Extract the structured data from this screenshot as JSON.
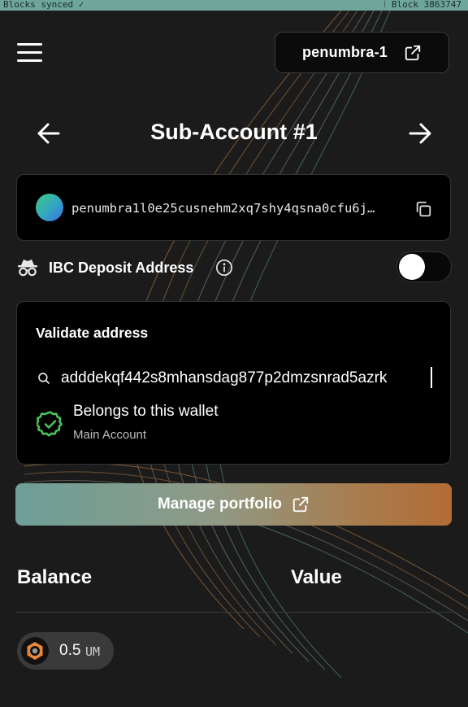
{
  "status_bar": {
    "sync_status": "Blocks synced ✓",
    "block_text": "⁝ Block 3863747"
  },
  "header": {
    "menu_icon": "hamburger-menu-icon",
    "chain_label": "penumbra-1",
    "external_icon": "external-link-icon"
  },
  "account": {
    "prev_icon": "arrow-left-icon",
    "title": "Sub-Account #1",
    "next_icon": "arrow-right-icon"
  },
  "address": {
    "text": "penumbra1l0e25cusnehm2xq7shy4qsna0cfu6j…",
    "copy_icon": "copy-icon"
  },
  "ibc": {
    "icon": "incognito-spy-icon",
    "label": "IBC Deposit Address",
    "info_icon": "info-icon",
    "toggle_on": false
  },
  "validate": {
    "title": "Validate address",
    "input_value": "adddekqf442s8mhansdag877p2dmzsnrad5azrk",
    "result_title": "Belongs to this wallet",
    "result_subtitle": "Main Account",
    "result_icon": "badge-check-icon"
  },
  "manage": {
    "label": "Manage portfolio"
  },
  "table": {
    "balance_header": "Balance",
    "value_header": "Value"
  },
  "balances": [
    {
      "amount": "0.5",
      "symbol": "UM",
      "icon": "penumbra-token-icon"
    }
  ],
  "colors": {
    "accent_teal": "#6d9f98",
    "accent_orange": "#b36c36",
    "success_green": "#4cc25a",
    "background": "#1b1b1b"
  }
}
